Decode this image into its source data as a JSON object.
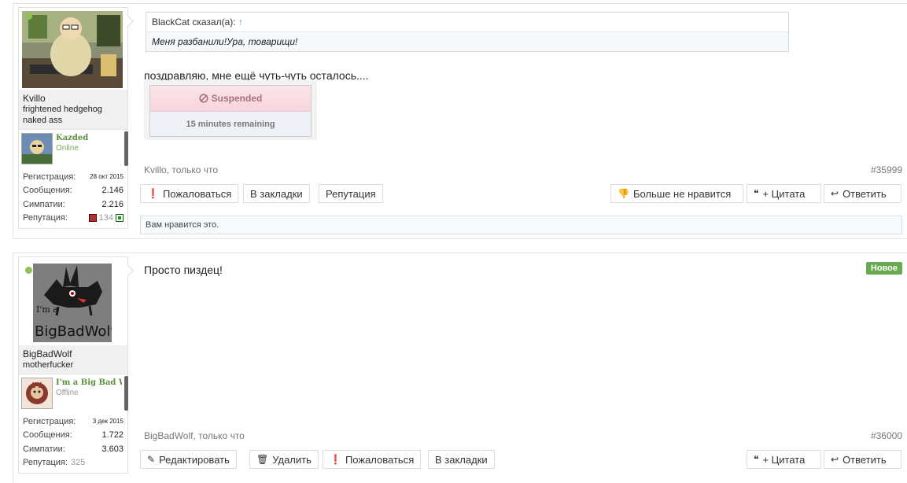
{
  "posts": [
    {
      "user": {
        "name": "Kvillo",
        "title_line1": "frightened hedgehog",
        "title_line2": "naked ass",
        "guest": {
          "name": "Kazded",
          "status": "Online"
        },
        "stats": [
          {
            "label": "Регистрация:",
            "value": "28 окт 2015"
          },
          {
            "label": "Сообщения:",
            "value": "2.146"
          },
          {
            "label": "Симпатии:",
            "value": "2.216"
          },
          {
            "label": "Репутация:",
            "value": "134"
          }
        ]
      },
      "quote": {
        "author": "BlackCat сказал(а):",
        "arrow": "↑",
        "text": "Меня разбанили!Ура, товарищи!"
      },
      "message": "поздравляю, мне ещё чуть-чуть осталось....",
      "suspended": {
        "title": "Suspended",
        "remaining": "15 minutes remaining"
      },
      "meta": "Kvillo, только что",
      "post_number": "#35999",
      "buttons_left": [
        "Пожаловаться",
        "В закладки",
        "Репутация"
      ],
      "buttons_right": [
        "Больше не нравится",
        "+ Цитата",
        "Ответить"
      ],
      "likes_text": "Вам нравится это."
    },
    {
      "user": {
        "name": "BigBadWolf",
        "title_line1": "motherfucker",
        "guest": {
          "name": "I'm a Big Bad Wolf",
          "status": "Offline"
        },
        "avatar_text_top": "I'm a",
        "avatar_text_bottom": "BigBadWolf",
        "stats": [
          {
            "label": "Регистрация:",
            "value": "3 дек 2015"
          },
          {
            "label": "Сообщения:",
            "value": "1.722"
          },
          {
            "label": "Симпатии:",
            "value": "3.603"
          },
          {
            "label": "Репутация:",
            "value": "325"
          }
        ]
      },
      "badge": "Новое",
      "message": "Просто пиздец!",
      "meta": "BigBadWolf, только что",
      "post_number": "#36000",
      "buttons_left": [
        "Редактировать",
        "Удалить",
        "Пожаловаться",
        "В закладки"
      ],
      "buttons_right": [
        "+ Цитата",
        "Ответить"
      ]
    }
  ],
  "colors": {
    "online": "#8fc15a",
    "new_badge": "#6aa84f",
    "suspended_text": "#a8707d",
    "link": "#4a90c2"
  }
}
